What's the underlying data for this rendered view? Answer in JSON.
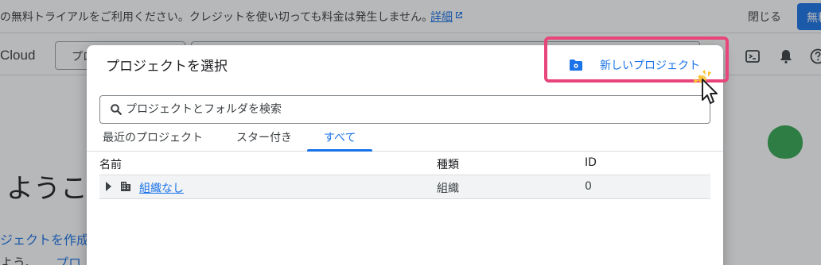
{
  "banner": {
    "text": "の無料トライアルをご利用ください。クレジットを使い切っても料金は発生しません。",
    "link": "詳細",
    "close": "閉じる",
    "button": "無料"
  },
  "topbar": {
    "brand": "Cloud",
    "project_picker": "プロ"
  },
  "background": {
    "welcome": "ようこ",
    "create_link": "ジェクトを作成",
    "line_text": "よう。",
    "line_link": "プロ"
  },
  "dialog": {
    "title": "プロジェクトを選択",
    "new_project": "新しいプロジェクト",
    "search": {
      "placeholder": "プロジェクトとフォルダを検索",
      "value": ""
    },
    "tabs": [
      {
        "label": "最近のプロジェクト",
        "active": false
      },
      {
        "label": "スター付き",
        "active": false
      },
      {
        "label": "すべて",
        "active": true
      }
    ],
    "table": {
      "headers": {
        "name": "名前",
        "type": "種類",
        "id": "ID"
      },
      "rows": [
        {
          "name": "組織なし",
          "type": "組織",
          "id": "0"
        }
      ]
    }
  },
  "icons": {
    "new_project": "add-folder-icon",
    "search": "search-icon",
    "org": "building-icon",
    "expand": "caret-right-icon",
    "terminal": "terminal-icon",
    "notifications": "bell-icon",
    "help": "help-icon",
    "external": "external-link-icon",
    "cursor": "mouse-pointer-icon"
  },
  "colors": {
    "accent": "#1a73e8",
    "highlight": "#e8457a",
    "blob": "#34a853"
  }
}
